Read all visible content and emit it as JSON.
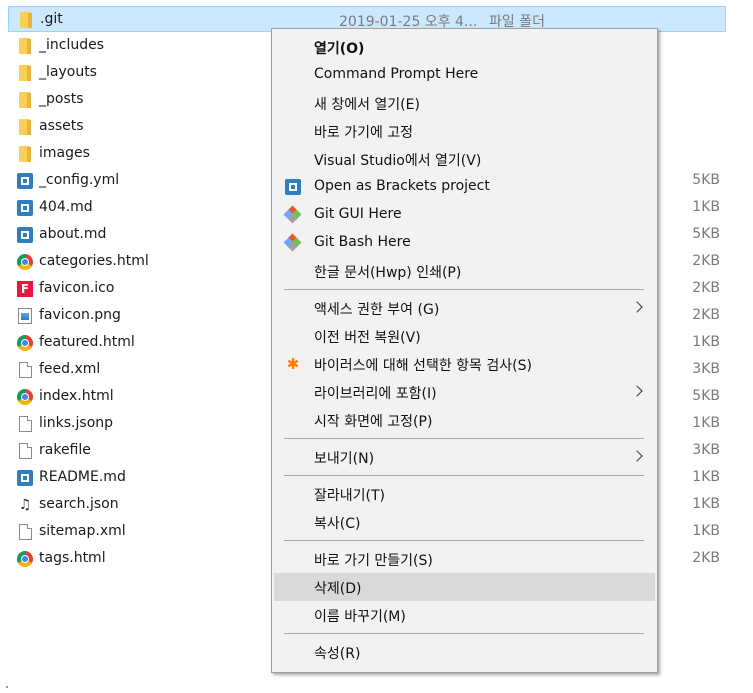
{
  "files": [
    {
      "name": ".git",
      "icon": "folder-icon",
      "date": "2019-01-25 오후 4...",
      "type": "파일 폴더",
      "size": "",
      "selected": true
    },
    {
      "name": "_includes",
      "icon": "folder-icon",
      "size": ""
    },
    {
      "name": "_layouts",
      "icon": "folder-icon",
      "size": ""
    },
    {
      "name": "_posts",
      "icon": "folder-icon",
      "size": ""
    },
    {
      "name": "assets",
      "icon": "folder-icon",
      "size": ""
    },
    {
      "name": "images",
      "icon": "folder-icon",
      "size": ""
    },
    {
      "name": "_config.yml",
      "icon": "brackets-file-icon",
      "size": "5KB"
    },
    {
      "name": "404.md",
      "icon": "brackets-file-icon",
      "size": "1KB"
    },
    {
      "name": "about.md",
      "icon": "brackets-file-icon",
      "size": "5KB"
    },
    {
      "name": "categories.html",
      "icon": "chrome-icon",
      "size": "2KB"
    },
    {
      "name": "favicon.ico",
      "icon": "favicon-icon",
      "size": "2KB"
    },
    {
      "name": "favicon.png",
      "icon": "image-file-icon",
      "size": "2KB"
    },
    {
      "name": "featured.html",
      "icon": "chrome-icon",
      "size": "1KB"
    },
    {
      "name": "feed.xml",
      "icon": "file-icon",
      "size": "3KB"
    },
    {
      "name": "index.html",
      "icon": "chrome-icon",
      "size": "5KB"
    },
    {
      "name": "links.jsonp",
      "icon": "file-icon",
      "size": "1KB"
    },
    {
      "name": "rakefile",
      "icon": "file-icon",
      "size": "3KB"
    },
    {
      "name": "README.md",
      "icon": "brackets-file-icon",
      "size": "1KB"
    },
    {
      "name": "search.json",
      "icon": "json-file-icon",
      "size": "1KB"
    },
    {
      "name": "sitemap.xml",
      "icon": "file-icon",
      "size": "1KB"
    },
    {
      "name": "tags.html",
      "icon": "chrome-icon",
      "size": "2KB"
    }
  ],
  "context_menu": {
    "items": [
      {
        "label": "열기(O)",
        "bold": true
      },
      {
        "label": "Command Prompt Here"
      },
      {
        "label": "새 창에서 열기(E)"
      },
      {
        "label": "바로 가기에 고정"
      },
      {
        "label": "Visual Studio에서 열기(V)"
      },
      {
        "label": "Open as Brackets project",
        "icon": "brackets-icon"
      },
      {
        "label": "Git GUI Here",
        "icon": "git-icon"
      },
      {
        "label": "Git Bash Here",
        "icon": "git-icon"
      },
      {
        "label": "한글 문서(Hwp) 인쇄(P)"
      },
      {
        "separator": true
      },
      {
        "label": "액세스 권한 부여 (G)",
        "submenu": true
      },
      {
        "label": "이전 버전 복원(V)"
      },
      {
        "label": "바이러스에 대해 선택한 항목 검사(S)",
        "icon": "avast-icon"
      },
      {
        "label": "라이브러리에 포함(I)",
        "submenu": true
      },
      {
        "label": "시작 화면에 고정(P)"
      },
      {
        "separator": true
      },
      {
        "label": "보내기(N)",
        "submenu": true
      },
      {
        "separator": true
      },
      {
        "label": "잘라내기(T)"
      },
      {
        "label": "복사(C)"
      },
      {
        "separator": true
      },
      {
        "label": "바로 가기 만들기(S)"
      },
      {
        "label": "삭제(D)",
        "highlighted": true
      },
      {
        "label": "이름 바꾸기(M)"
      },
      {
        "separator": true
      },
      {
        "label": "속성(R)"
      }
    ]
  },
  "colors": {
    "selection_bg": "#cce8ff",
    "menu_bg": "#f2f2f2",
    "menu_hover": "#d9d9d9"
  }
}
